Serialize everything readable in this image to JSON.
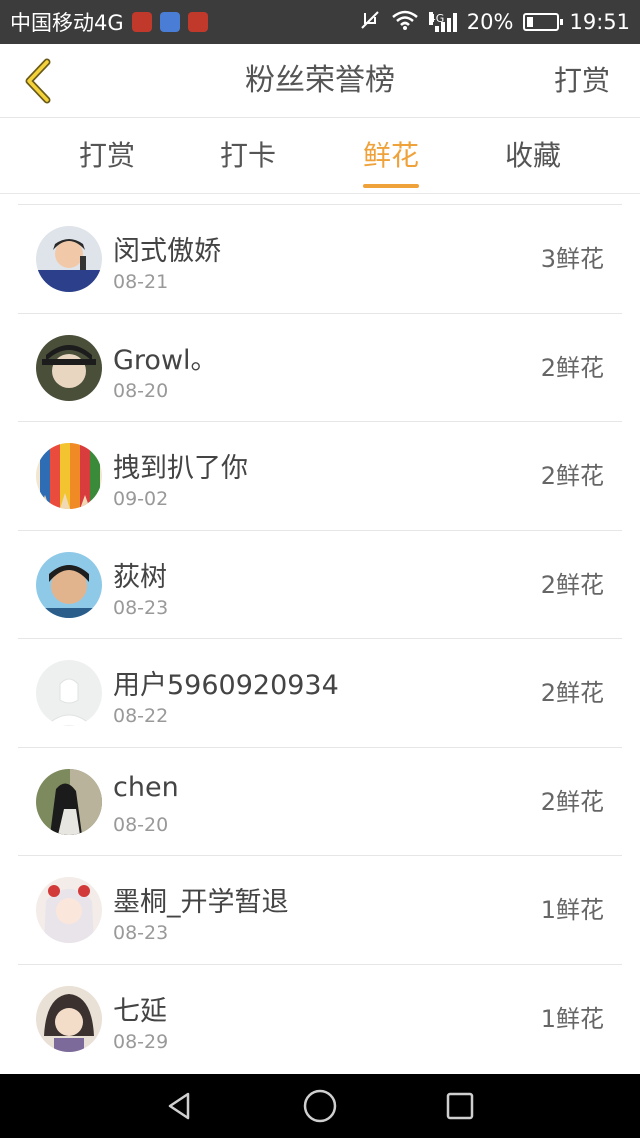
{
  "status_bar": {
    "carrier": "中国移动4G",
    "network": "4G",
    "battery_percent": "20%",
    "battery_level": 0.2,
    "time": "19:51",
    "icons": [
      "app-icon-1",
      "app-icon-2",
      "app-icon-3",
      "mute-icon",
      "wifi-icon",
      "signal-icon",
      "battery-icon"
    ]
  },
  "header": {
    "title": "粉丝荣誉榜",
    "action": "打赏",
    "back_icon": "chevron-left-icon"
  },
  "tabs": [
    {
      "label": "打赏",
      "active": false
    },
    {
      "label": "打卡",
      "active": false
    },
    {
      "label": "鲜花",
      "active": true
    },
    {
      "label": "收藏",
      "active": false
    }
  ],
  "list": [
    {
      "name": "闵式傲娇",
      "date": "08-21",
      "count": "3鲜花"
    },
    {
      "name": "Growl。",
      "date": "08-20",
      "count": "2鲜花"
    },
    {
      "name": "拽到扒了你",
      "date": "09-02",
      "count": "2鲜花"
    },
    {
      "name": "荻树",
      "date": "08-23",
      "count": "2鲜花"
    },
    {
      "name": "用户5960920934",
      "date": "08-22",
      "count": "2鲜花"
    },
    {
      "name": "chen",
      "date": "08-20",
      "count": "2鲜花"
    },
    {
      "name": "墨桐_开学暂退",
      "date": "08-23",
      "count": "1鲜花"
    },
    {
      "name": "七延",
      "date": "08-29",
      "count": "1鲜花"
    }
  ],
  "navbar": {
    "icons": [
      "back-triangle-icon",
      "home-circle-icon",
      "recents-square-icon"
    ]
  },
  "colors": {
    "accent": "#f0a23a",
    "statusbar": "#3c3c3c",
    "navbar": "#000000"
  }
}
